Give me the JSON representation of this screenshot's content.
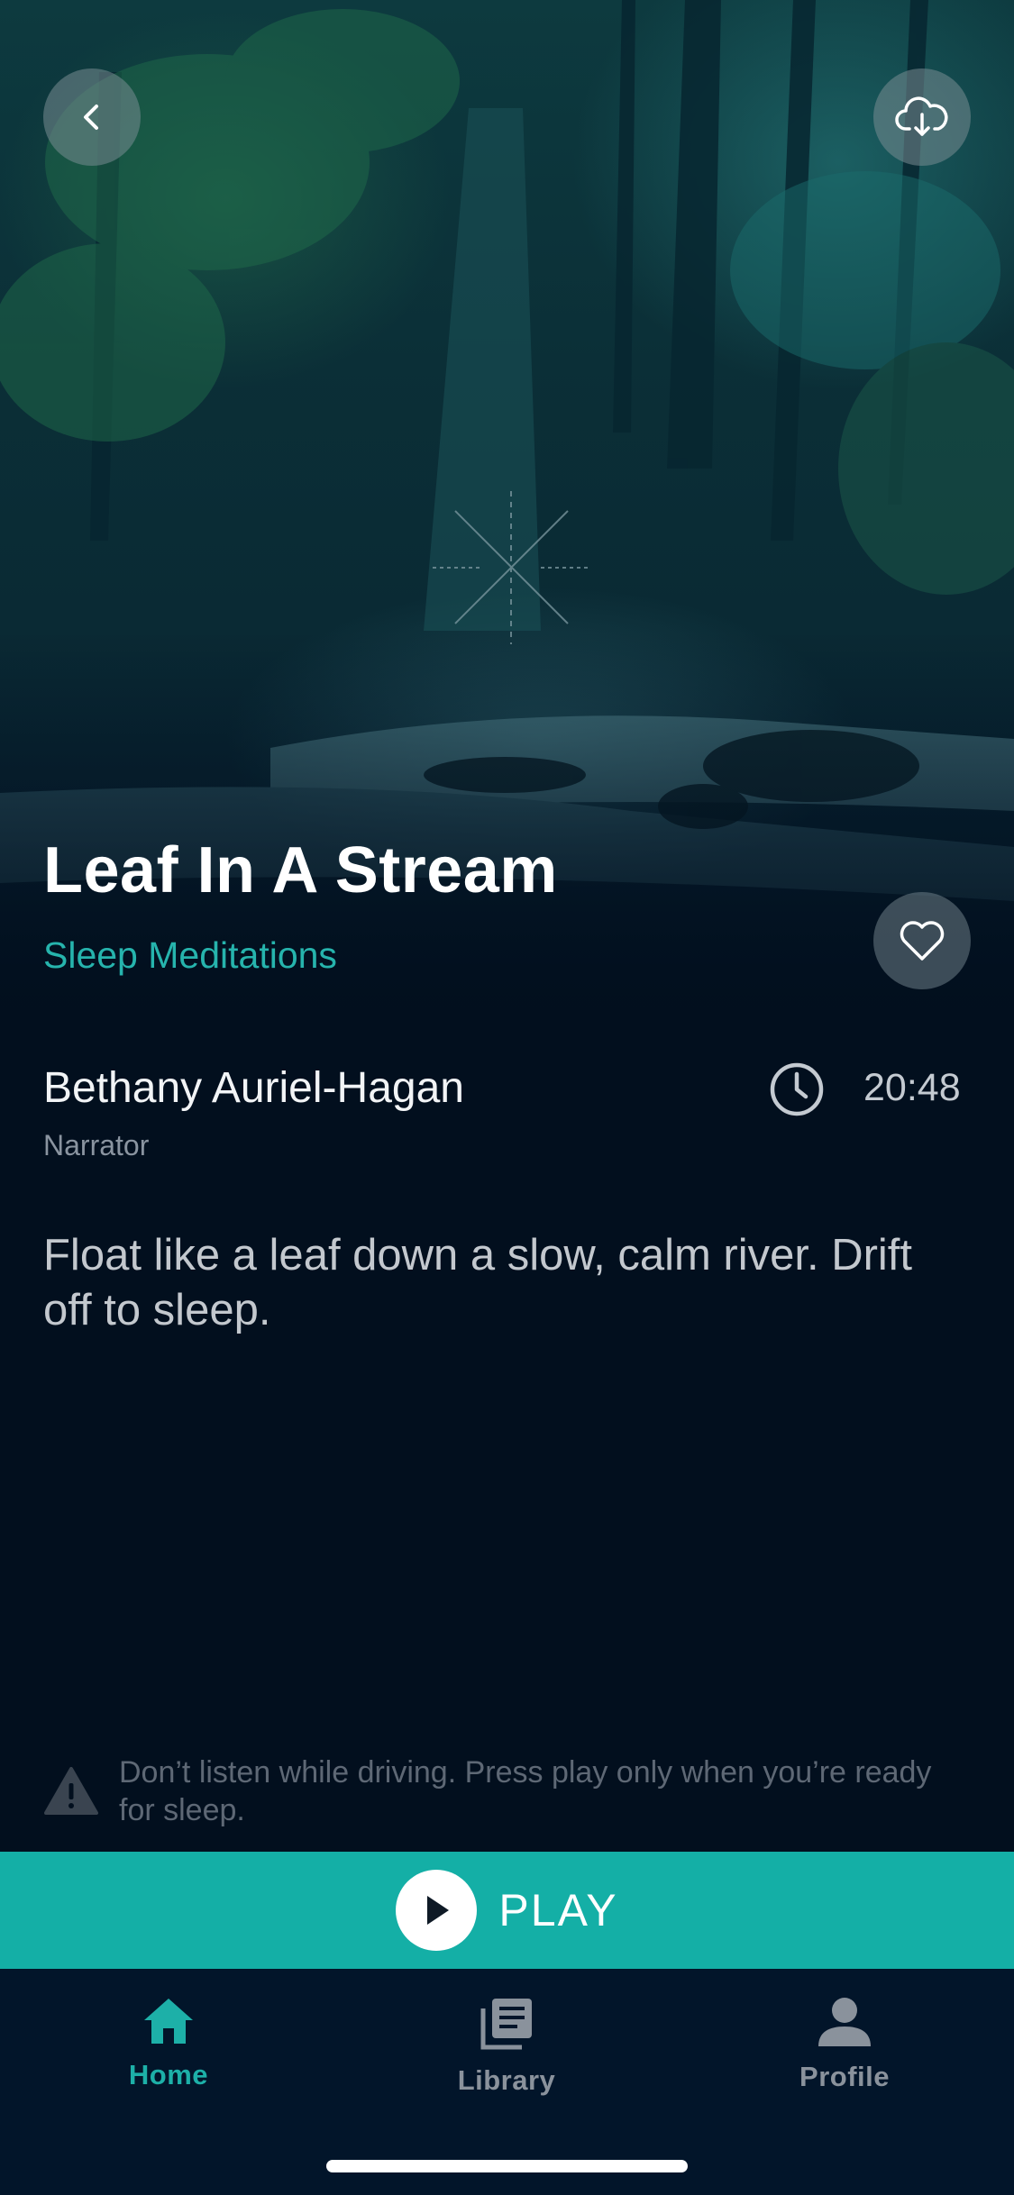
{
  "header": {
    "back_icon": "chevron-left-icon",
    "download_icon": "cloud-download-icon"
  },
  "track": {
    "title": "Leaf In A Stream",
    "category": "Sleep Meditations",
    "narrator_name": "Bethany Auriel-Hagan",
    "narrator_role": "Narrator",
    "duration": "20:48",
    "description": "Float like a leaf down a slow, calm river. Drift off to sleep.",
    "favorite_icon": "heart-outline-icon"
  },
  "warning": {
    "icon": "warning-triangle-icon",
    "text": "Don’t listen while driving. Press play only when you’re ready for sleep."
  },
  "play": {
    "label": "PLAY",
    "icon": "play-icon"
  },
  "tabs": [
    {
      "label": "Home",
      "icon": "home-icon",
      "active": true
    },
    {
      "label": "Library",
      "icon": "library-icon",
      "active": false
    },
    {
      "label": "Profile",
      "icon": "profile-icon",
      "active": false
    }
  ],
  "colors": {
    "accent": "#14afa6",
    "background": "#020f1e",
    "category_text": "#26b4ad",
    "tab_inactive": "#8a929c"
  }
}
